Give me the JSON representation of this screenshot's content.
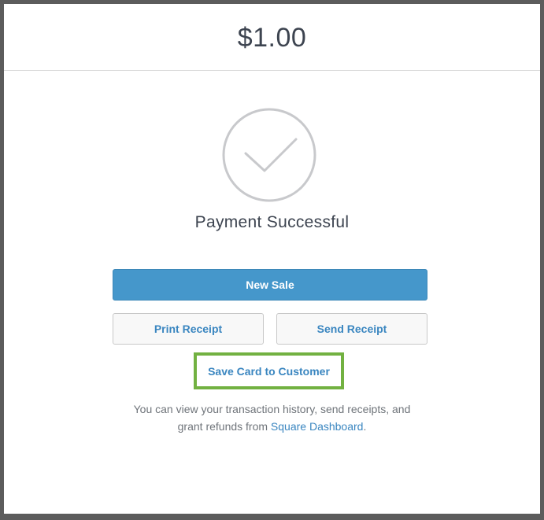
{
  "header": {
    "amount": "$1.00"
  },
  "status": {
    "title": "Payment Successful",
    "icon": "checkmark-circle-icon"
  },
  "actions": {
    "new_sale": "New Sale",
    "print_receipt": "Print Receipt",
    "send_receipt": "Send Receipt",
    "save_card": "Save Card to Customer"
  },
  "note": {
    "line1": "You can view your transaction history, send receipts, and",
    "line2_prefix": "grant refunds from ",
    "link_text": "Square Dashboard",
    "line2_suffix": "."
  },
  "colors": {
    "primary": "#4597cb",
    "link": "#3a86c0",
    "highlight": "#72b141",
    "text": "#3d4450",
    "muted": "#6f747a"
  }
}
